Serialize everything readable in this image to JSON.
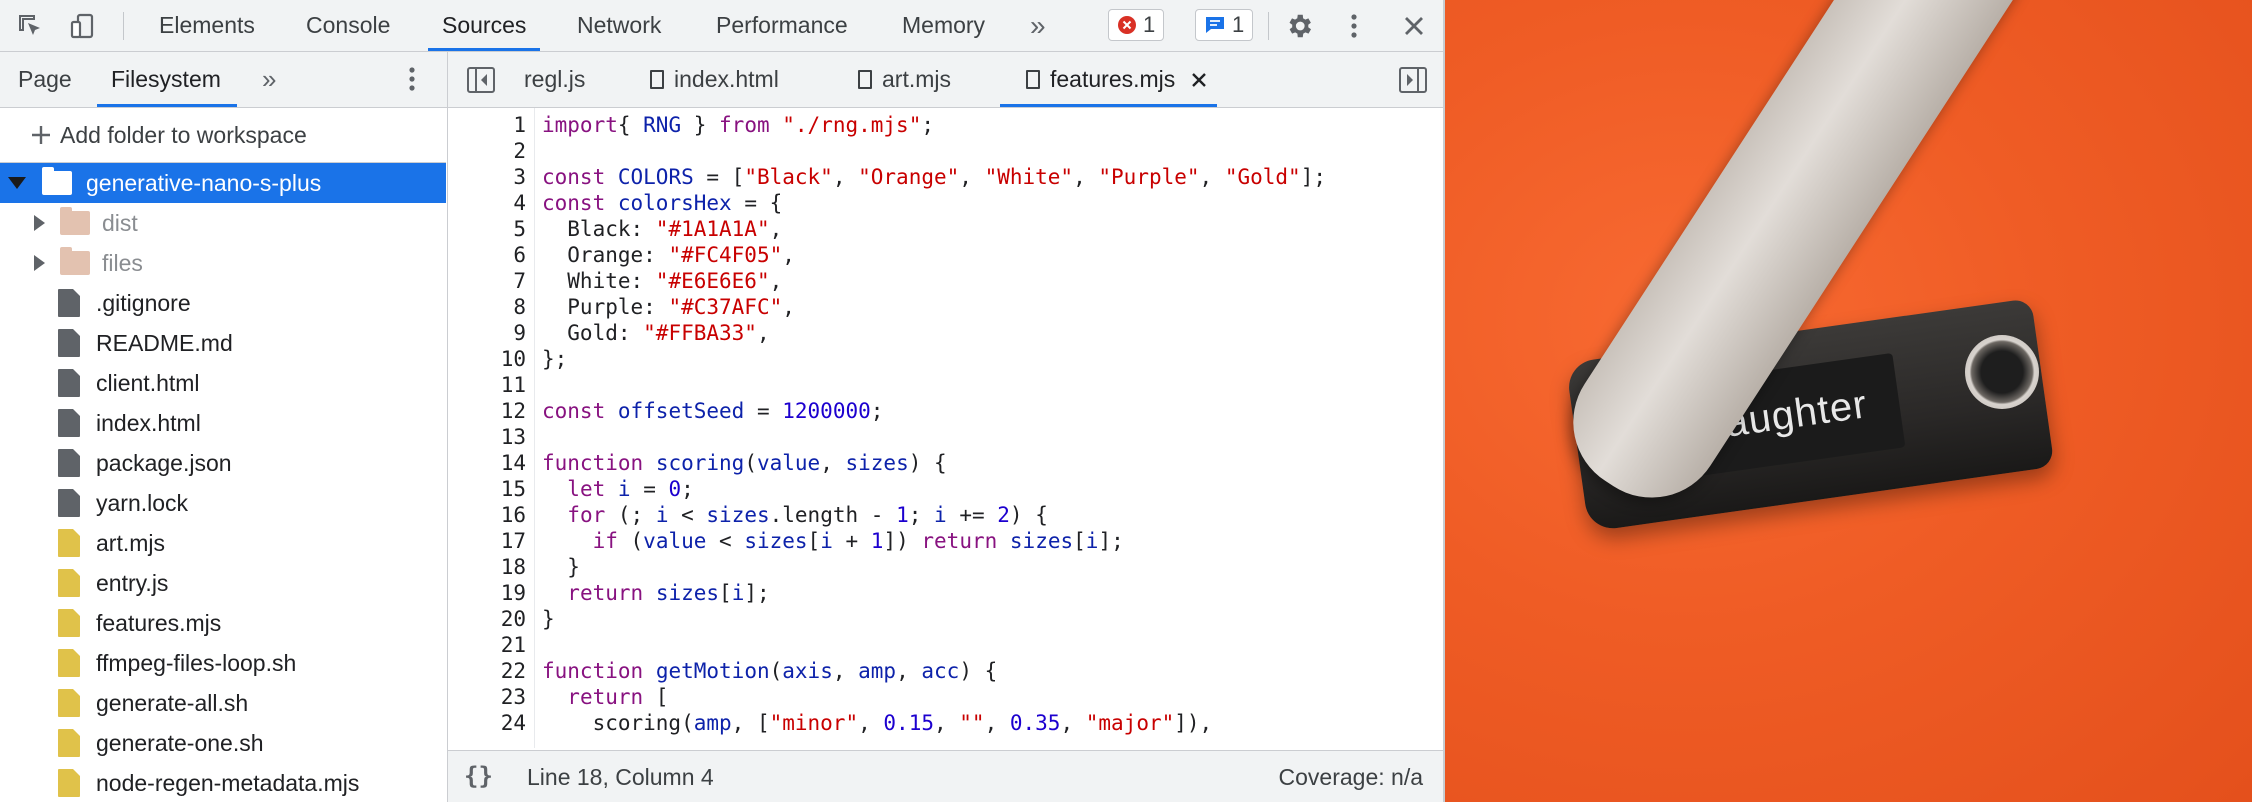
{
  "toolbar": {
    "tabs": [
      "Elements",
      "Console",
      "Sources",
      "Network",
      "Performance",
      "Memory"
    ],
    "more_tabs": "»",
    "errors_count": "1",
    "messages_count": "1"
  },
  "navigator": {
    "tabs": [
      "Page",
      "Filesystem"
    ],
    "more_tabs": "»",
    "add_folder_label": "Add folder to workspace",
    "root_folder": "generative-nano-s-plus",
    "items": [
      {
        "name": "dist",
        "type": "folder"
      },
      {
        "name": "files",
        "type": "folder"
      },
      {
        "name": ".gitignore",
        "type": "file",
        "color": "#5f6368"
      },
      {
        "name": "README.md",
        "type": "file",
        "color": "#5f6368"
      },
      {
        "name": "client.html",
        "type": "file",
        "color": "#5f6368"
      },
      {
        "name": "index.html",
        "type": "file",
        "color": "#5f6368"
      },
      {
        "name": "package.json",
        "type": "file",
        "color": "#5f6368"
      },
      {
        "name": "yarn.lock",
        "type": "file",
        "color": "#5f6368"
      },
      {
        "name": "art.mjs",
        "type": "file",
        "color": "#e0c24a"
      },
      {
        "name": "entry.js",
        "type": "file",
        "color": "#e0c24a"
      },
      {
        "name": "features.mjs",
        "type": "file",
        "color": "#e0c24a"
      },
      {
        "name": "ffmpeg-files-loop.sh",
        "type": "file",
        "color": "#e0c24a"
      },
      {
        "name": "generate-all.sh",
        "type": "file",
        "color": "#e0c24a"
      },
      {
        "name": "generate-one.sh",
        "type": "file",
        "color": "#e0c24a"
      },
      {
        "name": "node-regen-metadata.mjs",
        "type": "file",
        "color": "#e0c24a"
      }
    ]
  },
  "editor": {
    "tabs": [
      "regl.js",
      "index.html",
      "art.mjs",
      "features.mjs"
    ],
    "active_tab": "features.mjs",
    "lines": [
      [
        [
          "kw",
          "import"
        ],
        [
          "",
          "{ "
        ],
        [
          "id",
          "RNG"
        ],
        [
          "",
          " } "
        ],
        [
          "kw",
          "from"
        ],
        [
          "",
          " "
        ],
        [
          "str",
          "\"./rng.mjs\""
        ],
        [
          "",
          ";"
        ]
      ],
      [],
      [
        [
          "kw",
          "const"
        ],
        [
          "",
          " "
        ],
        [
          "id",
          "COLORS"
        ],
        [
          "",
          " = ["
        ],
        [
          "str",
          "\"Black\""
        ],
        [
          "",
          ", "
        ],
        [
          "str",
          "\"Orange\""
        ],
        [
          "",
          ", "
        ],
        [
          "str",
          "\"White\""
        ],
        [
          "",
          ", "
        ],
        [
          "str",
          "\"Purple\""
        ],
        [
          "",
          ", "
        ],
        [
          "str",
          "\"Gold\""
        ],
        [
          "",
          "];"
        ]
      ],
      [
        [
          "kw",
          "const"
        ],
        [
          "",
          " "
        ],
        [
          "id",
          "colorsHex"
        ],
        [
          "",
          " = {"
        ]
      ],
      [
        [
          "",
          "  Black: "
        ],
        [
          "str",
          "\"#1A1A1A\""
        ],
        [
          "",
          ","
        ]
      ],
      [
        [
          "",
          "  Orange: "
        ],
        [
          "str",
          "\"#FC4F05\""
        ],
        [
          "",
          ","
        ]
      ],
      [
        [
          "",
          "  White: "
        ],
        [
          "str",
          "\"#E6E6E6\""
        ],
        [
          "",
          ","
        ]
      ],
      [
        [
          "",
          "  Purple: "
        ],
        [
          "str",
          "\"#C37AFC\""
        ],
        [
          "",
          ","
        ]
      ],
      [
        [
          "",
          "  Gold: "
        ],
        [
          "str",
          "\"#FFBA33\""
        ],
        [
          "",
          ","
        ]
      ],
      [
        [
          "",
          "};"
        ]
      ],
      [],
      [
        [
          "kw",
          "const"
        ],
        [
          "",
          " "
        ],
        [
          "id",
          "offsetSeed"
        ],
        [
          "",
          " = "
        ],
        [
          "num",
          "1200000"
        ],
        [
          "",
          ";"
        ]
      ],
      [],
      [
        [
          "kw",
          "function"
        ],
        [
          "",
          " "
        ],
        [
          "id",
          "scoring"
        ],
        [
          "",
          "("
        ],
        [
          "id",
          "value"
        ],
        [
          "",
          ", "
        ],
        [
          "id",
          "sizes"
        ],
        [
          "",
          ") {"
        ]
      ],
      [
        [
          "",
          "  "
        ],
        [
          "kw",
          "let"
        ],
        [
          "",
          " "
        ],
        [
          "id",
          "i"
        ],
        [
          "",
          " = "
        ],
        [
          "num",
          "0"
        ],
        [
          "",
          ";"
        ]
      ],
      [
        [
          "",
          "  "
        ],
        [
          "kw",
          "for"
        ],
        [
          "",
          " (; "
        ],
        [
          "id",
          "i"
        ],
        [
          "",
          " < "
        ],
        [
          "id",
          "sizes"
        ],
        [
          "",
          ".length - "
        ],
        [
          "num",
          "1"
        ],
        [
          "",
          "; "
        ],
        [
          "id",
          "i"
        ],
        [
          "",
          " += "
        ],
        [
          "num",
          "2"
        ],
        [
          "",
          ") {"
        ]
      ],
      [
        [
          "",
          "    "
        ],
        [
          "kw",
          "if"
        ],
        [
          "",
          " ("
        ],
        [
          "id",
          "value"
        ],
        [
          "",
          " < "
        ],
        [
          "id",
          "sizes"
        ],
        [
          "",
          "["
        ],
        [
          "id",
          "i"
        ],
        [
          "",
          " + "
        ],
        [
          "num",
          "1"
        ],
        [
          "",
          "]) "
        ],
        [
          "kw",
          "return"
        ],
        [
          "",
          " "
        ],
        [
          "id",
          "sizes"
        ],
        [
          "",
          "["
        ],
        [
          "id",
          "i"
        ],
        [
          "",
          "];"
        ]
      ],
      [
        [
          "",
          "  }"
        ]
      ],
      [
        [
          "",
          "  "
        ],
        [
          "kw",
          "return"
        ],
        [
          "",
          " "
        ],
        [
          "id",
          "sizes"
        ],
        [
          "",
          "["
        ],
        [
          "id",
          "i"
        ],
        [
          "",
          "];"
        ]
      ],
      [
        [
          "",
          "}"
        ]
      ],
      [],
      [
        [
          "kw",
          "function"
        ],
        [
          "",
          " "
        ],
        [
          "id",
          "getMotion"
        ],
        [
          "",
          "("
        ],
        [
          "id",
          "axis"
        ],
        [
          "",
          ", "
        ],
        [
          "id",
          "amp"
        ],
        [
          "",
          ", "
        ],
        [
          "id",
          "acc"
        ],
        [
          "",
          ") {"
        ]
      ],
      [
        [
          "",
          "  "
        ],
        [
          "kw",
          "return"
        ],
        [
          "",
          " ["
        ]
      ],
      [
        [
          "",
          "    scoring("
        ],
        [
          "id",
          "amp"
        ],
        [
          "",
          ", ["
        ],
        [
          "str",
          "\"minor\""
        ],
        [
          "",
          ", "
        ],
        [
          "num",
          "0.15"
        ],
        [
          "",
          ", "
        ],
        [
          "str",
          "\"\""
        ],
        [
          "",
          ", "
        ],
        [
          "num",
          "0.35"
        ],
        [
          "",
          ", "
        ],
        [
          "str",
          "\"major\""
        ],
        [
          "",
          "]),"
        ]
      ]
    ],
    "status_position": "Line 18, Column 4",
    "status_coverage": "Coverage: n/a",
    "pretty_print": "{}"
  },
  "preview": {
    "device_text": "daughter"
  }
}
